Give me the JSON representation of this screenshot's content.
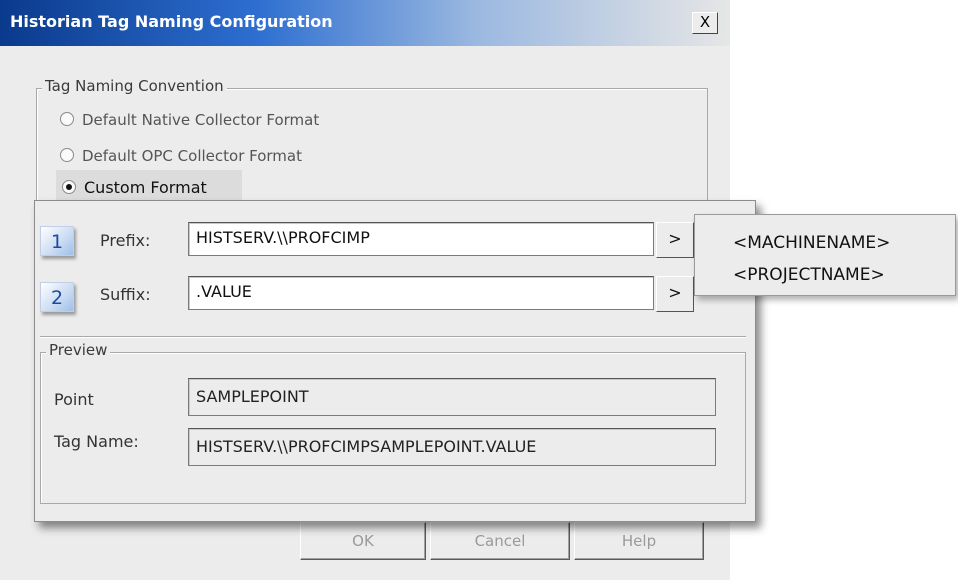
{
  "window": {
    "title": "Historian Tag Naming Configuration",
    "close_label": "X"
  },
  "naming_convention": {
    "legend": "Tag Naming Convention",
    "options": [
      {
        "label": "Default Native Collector Format",
        "selected": false
      },
      {
        "label": "Default OPC Collector Format",
        "selected": false
      },
      {
        "label": "Custom Format",
        "selected": true
      }
    ]
  },
  "custom_format": {
    "prefix": {
      "badge": "1",
      "label": "Prefix:",
      "value": "HISTSERV.\\\\PROFCIMP",
      "button": ">"
    },
    "suffix": {
      "badge": "2",
      "label": "Suffix:",
      "value": ".VALUE",
      "button": ">"
    }
  },
  "insert_menu": {
    "items": [
      "<MACHINENAME>",
      "<PROJECTNAME>"
    ]
  },
  "preview": {
    "legend": "Preview",
    "point_label": "Point",
    "point_value": "SAMPLEPOINT",
    "tagname_label": "Tag Name:",
    "tagname_value": "HISTSERV.\\\\PROFCIMPSAMPLEPOINT.VALUE"
  },
  "buttons": {
    "ok": "OK",
    "cancel": "Cancel",
    "help": "Help"
  }
}
